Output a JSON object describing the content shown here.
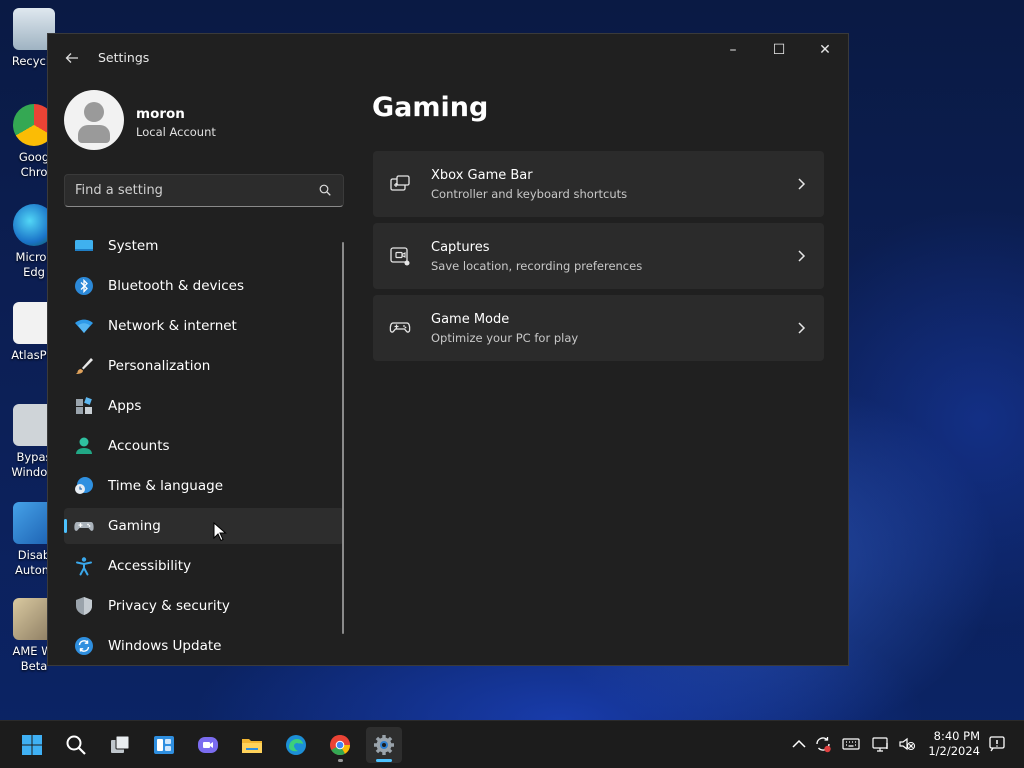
{
  "desktop": {
    "icons": [
      {
        "label": "Recycle"
      },
      {
        "label": "Goog\nChro"
      },
      {
        "label": "Micros\nEdg"
      },
      {
        "label": "AtlasPla"
      },
      {
        "label": "Bypas\nWindow"
      },
      {
        "label": "Disab\nAutom"
      },
      {
        "label": "AME Wi\nBeta"
      }
    ]
  },
  "window": {
    "title": "Settings",
    "caption": {
      "minimize": "–",
      "maximize": "☐",
      "close": "✕"
    }
  },
  "profile": {
    "name": "moron",
    "account_type": "Local Account"
  },
  "search": {
    "placeholder": "Find a setting"
  },
  "nav": {
    "items": [
      {
        "label": "System",
        "icon": "system-icon"
      },
      {
        "label": "Bluetooth & devices",
        "icon": "bluetooth-icon"
      },
      {
        "label": "Network & internet",
        "icon": "wifi-icon"
      },
      {
        "label": "Personalization",
        "icon": "brush-icon"
      },
      {
        "label": "Apps",
        "icon": "apps-icon"
      },
      {
        "label": "Accounts",
        "icon": "accounts-icon"
      },
      {
        "label": "Time & language",
        "icon": "time-language-icon"
      },
      {
        "label": "Gaming",
        "icon": "gamepad-icon",
        "selected": true
      },
      {
        "label": "Accessibility",
        "icon": "accessibility-icon"
      },
      {
        "label": "Privacy & security",
        "icon": "shield-icon"
      },
      {
        "label": "Windows Update",
        "icon": "update-icon"
      }
    ]
  },
  "main": {
    "title": "Gaming",
    "cards": [
      {
        "title": "Xbox Game Bar",
        "subtitle": "Controller and keyboard shortcuts",
        "icon": "game-bar-icon"
      },
      {
        "title": "Captures",
        "subtitle": "Save location, recording preferences",
        "icon": "capture-icon"
      },
      {
        "title": "Game Mode",
        "subtitle": "Optimize your PC for play",
        "icon": "game-mode-icon"
      }
    ]
  },
  "taskbar": {
    "apps": [
      "start-icon",
      "search-icon",
      "task-view-icon",
      "widgets-icon",
      "teams-chat-icon",
      "file-explorer-icon",
      "edge-icon",
      "chrome-icon",
      "settings-icon"
    ],
    "clock": {
      "time": "8:40 PM",
      "date": "1/2/2024"
    }
  },
  "colors": {
    "accent": "#4cc2ff",
    "window_bg": "#202020",
    "card_bg": "#2b2b2b"
  }
}
